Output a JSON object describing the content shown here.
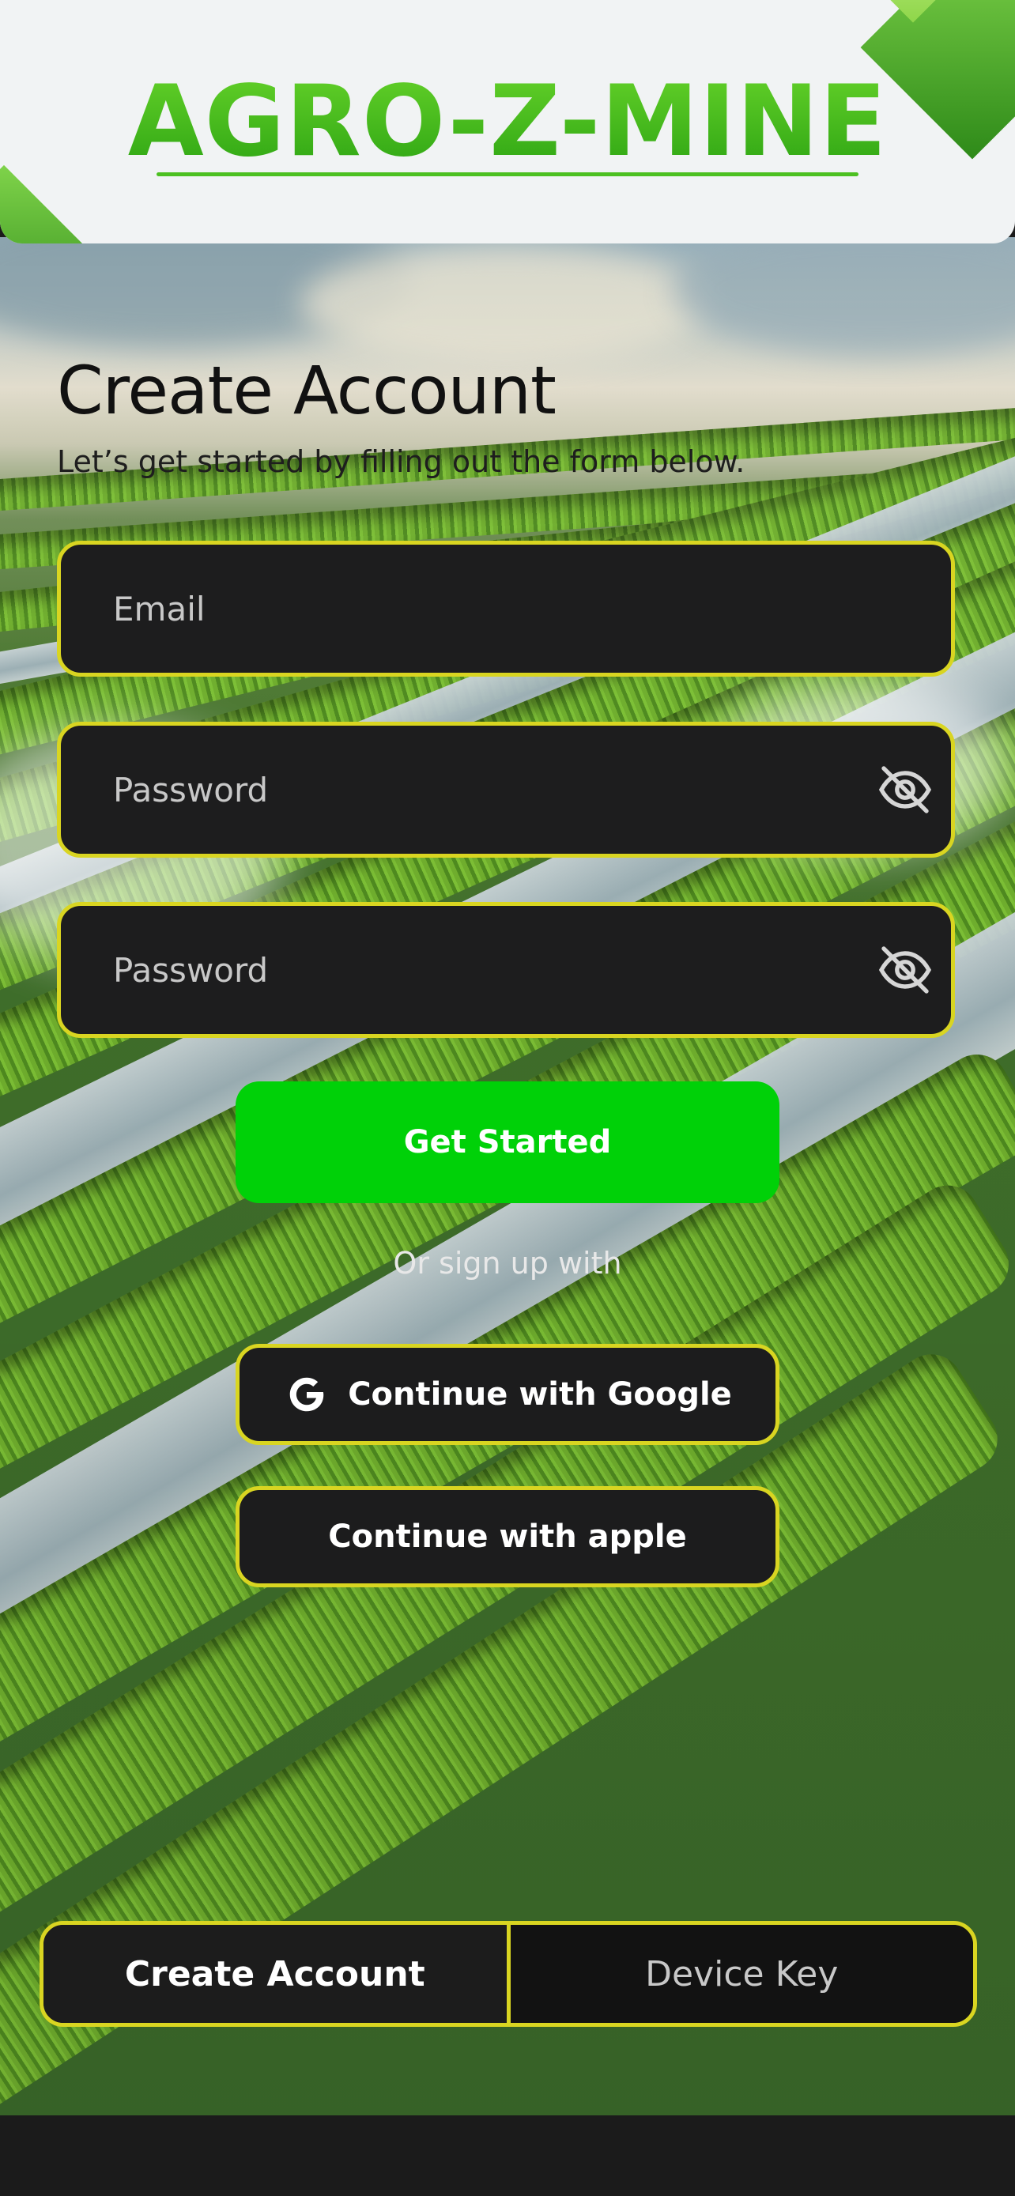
{
  "header": {
    "logo_text": "AGRO-Z-MINE",
    "brand_color": "#36b41a"
  },
  "form": {
    "title": "Create Account",
    "subtitle": "Let’s get started by filling out the form below.",
    "email_placeholder": "Email",
    "password_placeholder": "Password",
    "confirm_password_placeholder": "Password",
    "password_toggle_icon": "eye-off-icon",
    "submit_label": "Get Started",
    "or_text": "Or sign up with",
    "google_label": "Continue with Google",
    "google_icon": "google-icon",
    "apple_label": "Continue with apple"
  },
  "tabs": {
    "items": [
      {
        "label": "Create Account",
        "active": true
      },
      {
        "label": "Device Key",
        "active": false
      }
    ]
  },
  "colors": {
    "accent_border": "#d9d521",
    "primary_button": "#00d108",
    "field_background": "#1d1d1e"
  }
}
